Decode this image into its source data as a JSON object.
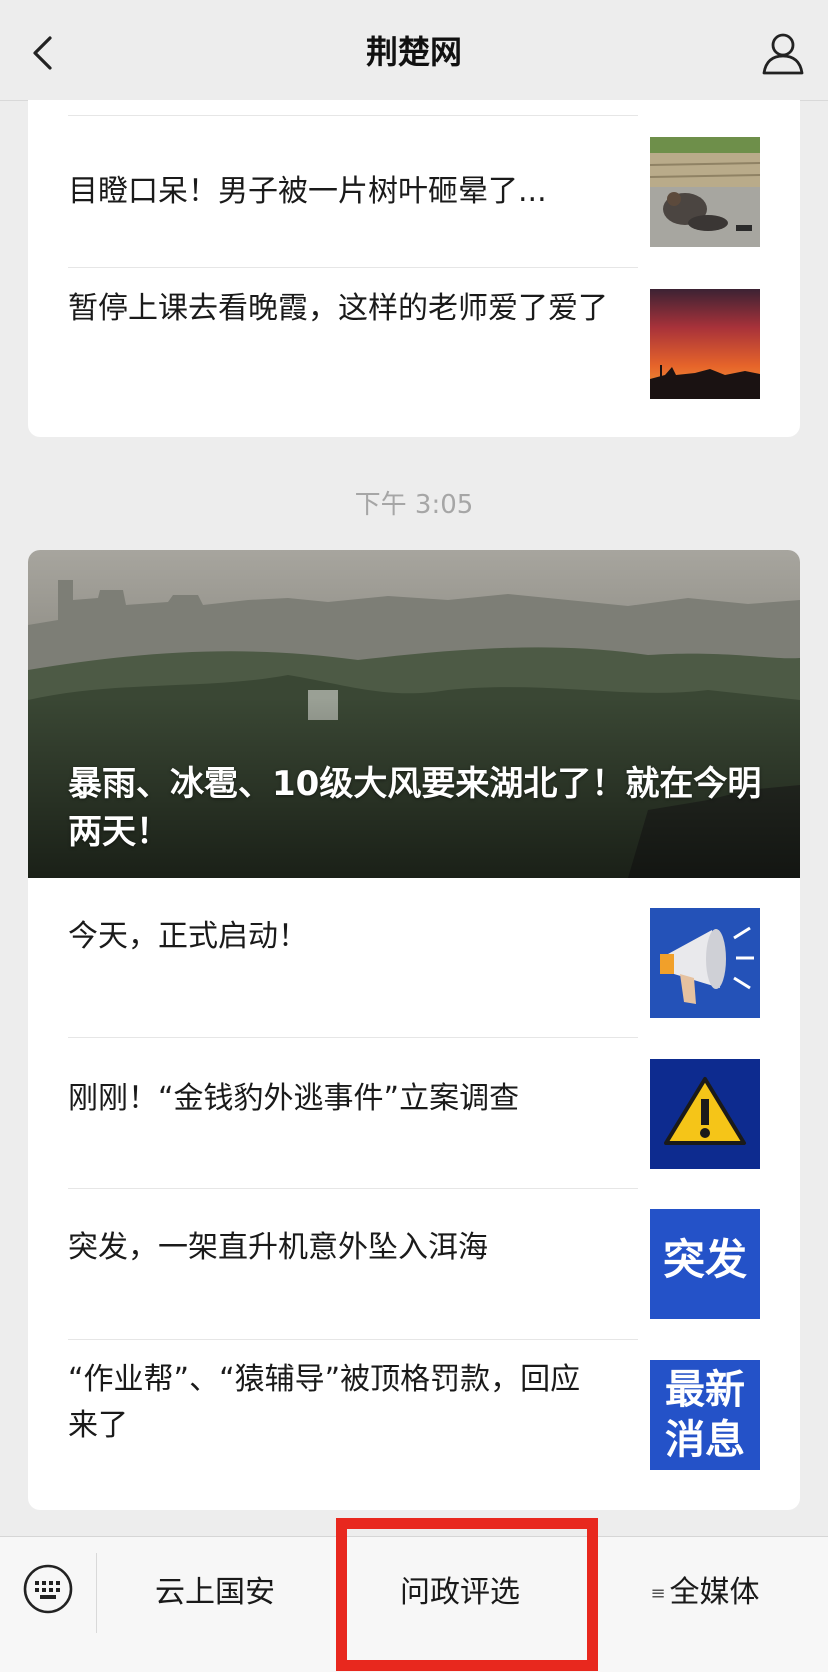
{
  "header": {
    "title": "荆楚网",
    "back_icon": "chevron-left-icon",
    "profile_icon": "user-icon"
  },
  "articles_top": [
    {
      "title": "目瞪口呆！男子被一片树叶砸晕了...",
      "thumb": "man-on-ground-photo"
    },
    {
      "title": "暂停上课去看晚霞，这样的老师爱了爱了",
      "thumb": "sunset-sky-photo"
    }
  ],
  "timestamp": "下午 3:05",
  "hero": {
    "title": "暴雨、冰雹、10级大风要来湖北了！就在今明两天！",
    "image": "stormy-landscape-photo"
  },
  "articles_bottom": [
    {
      "title": "今天，正式启动！",
      "thumb": "megaphone-icon"
    },
    {
      "title": "刚刚！“金钱豹外逃事件”立案调查",
      "thumb": "warning-icon"
    },
    {
      "title": "突发，一架直升机意外坠入洱海",
      "thumb": "breaking-news-banner",
      "thumb_text": "突发"
    },
    {
      "title": "“作业帮”、“猿辅导”被顶格罚款，回应来了",
      "thumb": "latest-news-banner",
      "thumb_text": "最新消息"
    }
  ],
  "bottom_menu": {
    "keyboard_icon": "keyboard-icon",
    "items": [
      "云上国安",
      "问政评选",
      "全媒体"
    ],
    "submenu_glyph": "≡"
  },
  "colors": {
    "background": "#ededed",
    "highlight": "#e8281e",
    "thumb_blue": "#1d3fa8"
  }
}
